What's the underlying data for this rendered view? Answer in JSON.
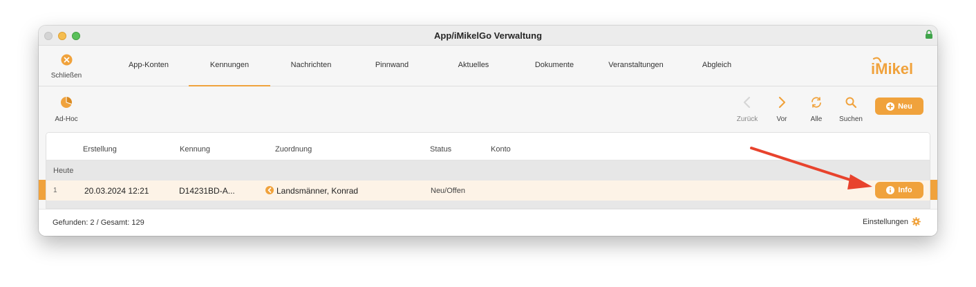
{
  "window": {
    "title": "App/iMikelGo Verwaltung"
  },
  "nav": {
    "close_label": "Schließen",
    "tabs": [
      {
        "label": "App-Konten"
      },
      {
        "label": "Kennungen"
      },
      {
        "label": "Nachrichten"
      },
      {
        "label": "Pinnwand"
      },
      {
        "label": "Aktuelles"
      },
      {
        "label": "Dokumente"
      },
      {
        "label": "Veranstaltungen"
      },
      {
        "label": "Abgleich"
      }
    ],
    "active_tab": "Kennungen",
    "logo_text": "iMikel"
  },
  "toolbar": {
    "adhoc_label": "Ad-Hoc",
    "back_label": "Zurück",
    "forward_label": "Vor",
    "all_label": "Alle",
    "search_label": "Suchen",
    "new_label": "Neu"
  },
  "table": {
    "columns": [
      "Erstellung",
      "Kennung",
      "Zuordnung",
      "Status",
      "Konto"
    ],
    "group_label": "Heute",
    "rows": [
      {
        "num": "1",
        "erstellung": "20.03.2024 12:21",
        "kennung": "D14231BD-A...",
        "zuordnung": "Landsmänner, Konrad",
        "status": "Neu/Offen",
        "konto": "",
        "action_label": "Info"
      }
    ]
  },
  "footer": {
    "count_text": "Gefunden: 2 / Gesamt: 129",
    "settings_label": "Einstellungen"
  },
  "colors": {
    "accent": "#f0a23c",
    "selected_row": "#fdf3e7",
    "annotation_arrow": "#e8432d"
  }
}
